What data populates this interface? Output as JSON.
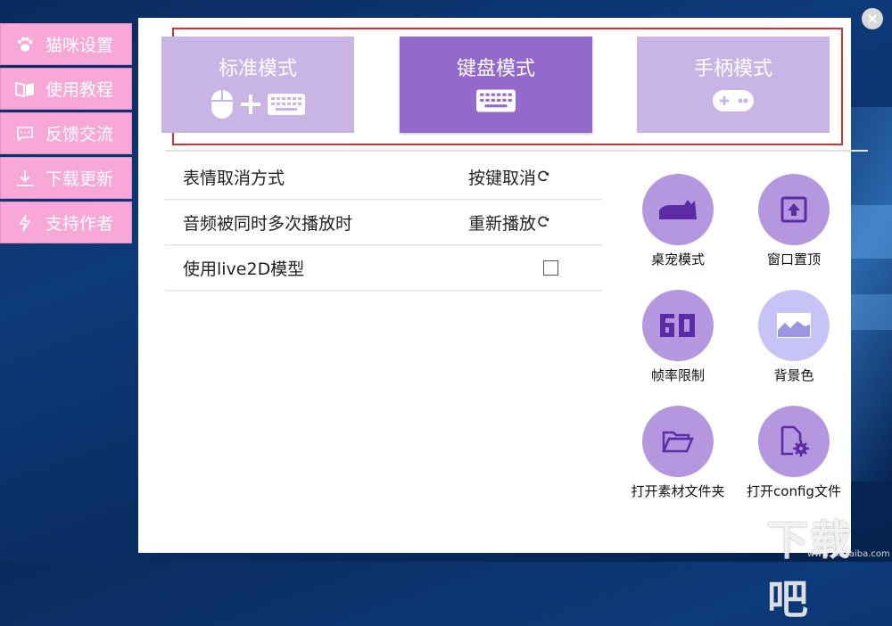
{
  "sidebar": {
    "items": [
      {
        "label": "猫咪设置",
        "icon": "paw-icon"
      },
      {
        "label": "使用教程",
        "icon": "book-icon"
      },
      {
        "label": "反馈交流",
        "icon": "chat-icon"
      },
      {
        "label": "下载更新",
        "icon": "download-icon"
      },
      {
        "label": "支持作者",
        "icon": "lightning-icon"
      }
    ]
  },
  "modes": {
    "standard": {
      "label": "标准模式",
      "icon": "mouse-plus-keyboard-icon"
    },
    "keyboard": {
      "label": "键盘模式",
      "icon": "keyboard-icon",
      "selected": true
    },
    "gamepad": {
      "label": "手柄模式",
      "icon": "gamepad-icon"
    }
  },
  "settings": {
    "rows": [
      {
        "label": "表情取消方式",
        "value": "按键取消"
      },
      {
        "label": "音频被同时多次播放时",
        "value": "重新播放"
      },
      {
        "label": "使用live2D模型",
        "checked": false
      }
    ]
  },
  "tools": {
    "pet_mode": {
      "label": "桌宠模式",
      "icon": "cat-silhouette-icon"
    },
    "window_top": {
      "label": "窗口置顶",
      "icon": "pin-top-icon"
    },
    "fps_limit": {
      "label": "帧率限制",
      "icon": "fps-60-icon"
    },
    "bg_color": {
      "label": "背景色",
      "icon": "image-icon"
    },
    "open_assets": {
      "label": "打开素材文件夹",
      "icon": "folder-open-icon"
    },
    "open_config": {
      "label": "打开config文件",
      "icon": "config-file-icon"
    }
  },
  "watermark": {
    "text": "下载吧",
    "sub": "www.xiazaiba.com"
  },
  "colors": {
    "sidebar_pink": "#f7a8d7",
    "mode_light": "#c9b4e6",
    "mode_selected": "#9369cc",
    "tool_circle": "#b497de",
    "tool_circle_light": "#c8c3f6",
    "highlight_frame": "#d93030",
    "icon_dark_purple": "#5b2ca6"
  }
}
